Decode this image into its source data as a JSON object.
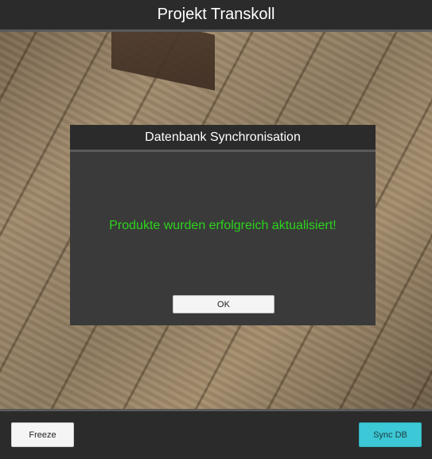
{
  "app": {
    "title": "Projekt Transkoll"
  },
  "dialog": {
    "title": "Datenbank Synchronisation",
    "message": "Produkte wurden erfolgreich aktualisiert!",
    "ok_label": "OK",
    "message_color": "#2bd41b"
  },
  "toolbar": {
    "freeze_label": "Freeze",
    "sync_label": "Sync DB",
    "sync_color": "#3cc8d6"
  }
}
